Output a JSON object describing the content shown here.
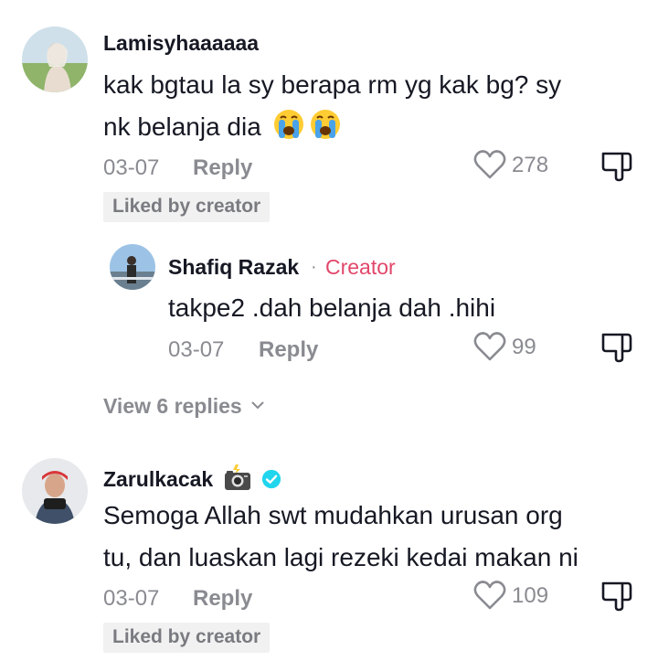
{
  "comments": [
    {
      "username": "Lamisyhaaaaaa",
      "text_line1": "kak bgtau la sy berapa rm yg kak bg? sy",
      "text_line2": "nk belanja dia",
      "emojis": [
        "loudly-crying-face",
        "loudly-crying-face"
      ],
      "date": "03-07",
      "reply_label": "Reply",
      "likes": "278",
      "badge": "Liked by creator"
    },
    {
      "username": "Zarulkacak",
      "username_emoji": "camera-with-flash",
      "verified": true,
      "text_line1": "Semoga Allah swt mudahkan urusan org",
      "text_line2": "tu, dan luaskan lagi rezeki kedai makan ni",
      "date": "03-07",
      "reply_label": "Reply",
      "likes": "109",
      "badge": "Liked by creator"
    }
  ],
  "reply": {
    "username": "Shafiq Razak",
    "separator": "·",
    "role": "Creator",
    "text": "takpe2 .dah belanja dah .hihi",
    "date": "03-07",
    "reply_label": "Reply",
    "likes": "99"
  },
  "view_replies": "View 6 replies",
  "colors": {
    "creator": "#e2466a",
    "muted": "#8a8b91",
    "verified": "#20d5ec",
    "text": "#161823"
  }
}
